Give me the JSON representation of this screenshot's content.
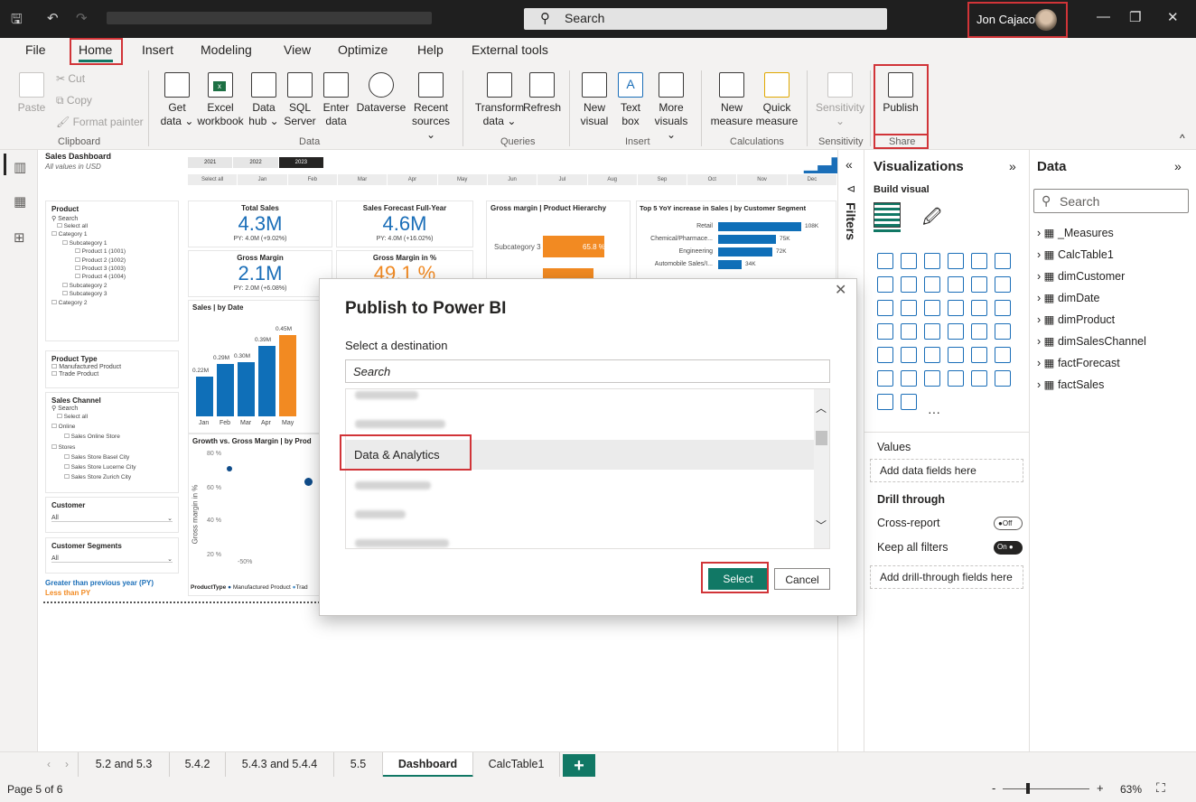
{
  "titlebar": {
    "search_placeholder": "Search",
    "user_name": "Jon Cajacob"
  },
  "menu": {
    "tabs": [
      "File",
      "Home",
      "Insert",
      "Modeling",
      "View",
      "Optimize",
      "Help",
      "External tools"
    ]
  },
  "ribbon": {
    "clipboard": {
      "paste": "Paste",
      "cut": "Cut",
      "copy": "Copy",
      "format_painter": "Format painter",
      "group": "Clipboard"
    },
    "data": {
      "get_data": [
        "Get",
        "data ⌄"
      ],
      "excel": [
        "Excel",
        "workbook"
      ],
      "data_hub": [
        "Data",
        "hub ⌄"
      ],
      "sql": [
        "SQL",
        "Server"
      ],
      "enter_data": [
        "Enter",
        "data"
      ],
      "dataverse": "Dataverse",
      "recent": [
        "Recent",
        "sources ⌄"
      ],
      "group": "Data"
    },
    "queries": {
      "transform": [
        "Transform",
        "data ⌄"
      ],
      "refresh": "Refresh",
      "group": "Queries"
    },
    "insert": {
      "new_visual": [
        "New",
        "visual"
      ],
      "text_box": [
        "Text",
        "box"
      ],
      "more_visuals": [
        "More",
        "visuals ⌄"
      ],
      "group": "Insert"
    },
    "calculations": {
      "new_measure": [
        "New",
        "measure"
      ],
      "quick_measure": [
        "Quick",
        "measure"
      ],
      "group": "Calculations"
    },
    "sensitivity": {
      "label": "Sensitivity",
      "group": "Sensitivity"
    },
    "share": {
      "publish": "Publish",
      "group": "Share"
    }
  },
  "report": {
    "title": "Sales Dashboard",
    "subtitle": "All values in USD",
    "years": [
      "2021",
      "2022",
      "2023"
    ],
    "months": [
      "Select all",
      "Jan",
      "Feb",
      "Mar",
      "Apr",
      "May",
      "Jun",
      "Jul",
      "Aug",
      "Sep",
      "Oct",
      "Nov",
      "Dec"
    ],
    "product_slicer": {
      "title": "Product",
      "search": "Search",
      "items": [
        "Select all",
        "Category 1",
        "Subcategory 1",
        "Product 1 (1001)",
        "Product 2 (1002)",
        "Product 3 (1003)",
        "Product 4 (1004)",
        "Subcategory 2",
        "Subcategory 3",
        "Category 2"
      ]
    },
    "product_type": {
      "title": "Product Type",
      "items": [
        "Manufactured Product",
        "Trade Product"
      ]
    },
    "sales_channel": {
      "title": "Sales Channel",
      "search": "Search",
      "items": [
        "Select all",
        "Online",
        "Sales Online Store",
        "Stores",
        "Sales Store Basel City",
        "Sales Store Lucerne City",
        "Sales Store Zurich City"
      ]
    },
    "customer": {
      "title": "Customer",
      "value": "All"
    },
    "customer_segments": {
      "title": "Customer Segments",
      "value": "All"
    },
    "legend_text": {
      "greater": "Greater than previous year (PY)",
      "less": "Less than PY"
    },
    "kpis": [
      {
        "title": "Total Sales",
        "value": "4.3M",
        "sub": "PY: 4.0M (+9.02%)"
      },
      {
        "title": "Sales Forecast Full-Year",
        "value": "4.6M",
        "sub": "PY: 4.0M (+16.02%)"
      },
      {
        "title": "Gross Margin",
        "value": "2.1M",
        "sub": "PY: 2.0M (+6.08%)"
      },
      {
        "title": "Gross Margin in %",
        "value": "49.1 %",
        "sub": ""
      }
    ],
    "gm_hierarchy": {
      "title": "Gross margin | Product Hierarchy",
      "label": "Subcategory 3",
      "value": "65.8 %"
    },
    "top5": {
      "title": "Top 5 YoY increase in Sales | by Customer Segment",
      "rows": [
        {
          "label": "Retail",
          "value": "108K"
        },
        {
          "label": "Chemical/Pharmace...",
          "value": "75K"
        },
        {
          "label": "Engineering",
          "value": "72K"
        },
        {
          "label": "Automobile Sales/I...",
          "value": "34K"
        }
      ]
    },
    "sales_by_date": {
      "title": "Sales | by Date",
      "categories": [
        "Jan",
        "Feb",
        "Mar",
        "Apr",
        "May"
      ],
      "values": [
        0.22,
        0.29,
        0.3,
        0.39,
        0.45
      ],
      "labels": [
        "0.22M",
        "0.29M",
        "0.30M",
        "0.39M",
        "0.45M"
      ]
    },
    "growth": {
      "title": "Growth vs. Gross Margin | by Prod",
      "ylabel": "Gross margin in %",
      "yticks": [
        "80 %",
        "60 %",
        "40 %",
        "20 %"
      ],
      "xtick": "-50%",
      "legend_title": "ProductType",
      "legend_items": [
        "Manufactured Product",
        "Trad"
      ]
    }
  },
  "filters": {
    "label": "Filters"
  },
  "visualizations": {
    "title": "Visualizations",
    "build_visual": "Build visual",
    "values": "Values",
    "add_data": "Add data fields here",
    "drill": "Drill through",
    "cross_report": "Cross-report",
    "cross_state": "Off",
    "keep_filters": "Keep all filters",
    "keep_state": "On",
    "add_drill": "Add drill-through fields here"
  },
  "data_pane": {
    "title": "Data",
    "search": "Search",
    "tables": [
      "_Measures",
      "CalcTable1",
      "dimCustomer",
      "dimDate",
      "dimProduct",
      "dimSalesChannel",
      "factForecast",
      "factSales"
    ]
  },
  "modal": {
    "title": "Publish to Power BI",
    "subtitle": "Select a destination",
    "search_placeholder": "Search",
    "selected_item": "Data & Analytics",
    "select_label": "Select",
    "cancel_label": "Cancel"
  },
  "pages": {
    "tabs": [
      "5.2 and 5.3",
      "5.4.2",
      "5.4.3 and 5.4.4",
      "5.5",
      "Dashboard",
      "CalcTable1"
    ],
    "active": "Dashboard"
  },
  "status": {
    "page": "Page 5 of 6",
    "zoom": "63%"
  },
  "colors": {
    "accent": "#117865",
    "highlight": "#d13438",
    "bar_blue": "#0f6fb8",
    "bar_orange": "#f28a22"
  }
}
